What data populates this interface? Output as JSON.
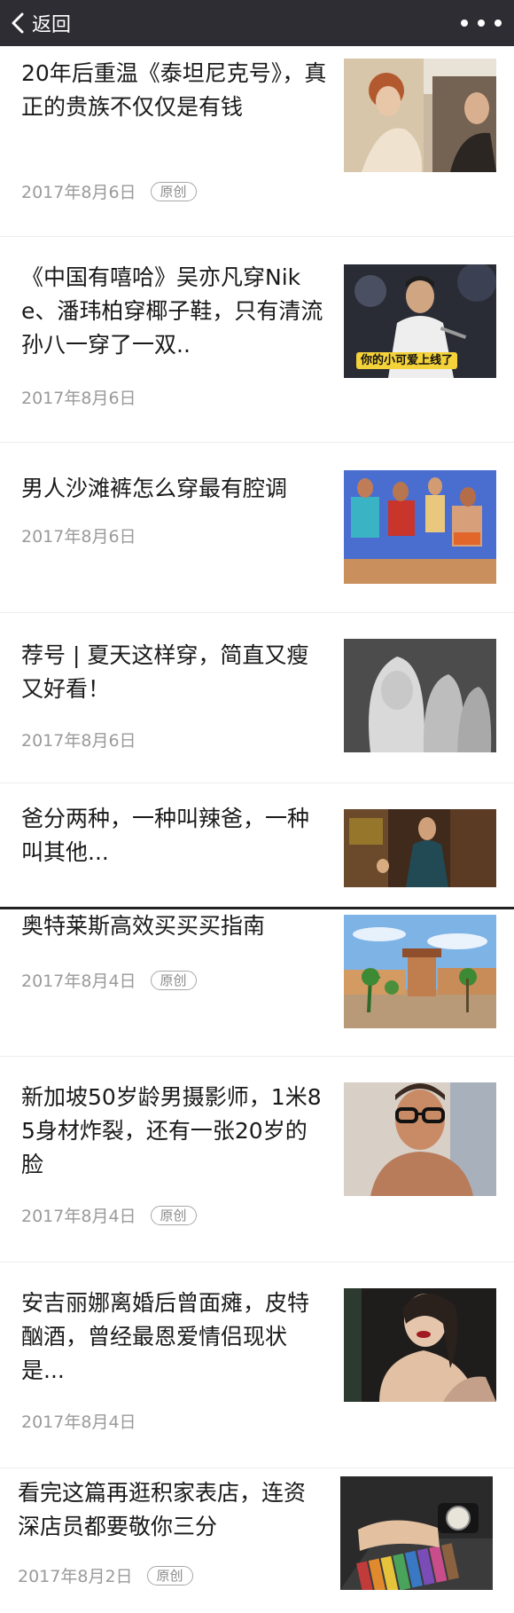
{
  "nav": {
    "back_label": "返回"
  },
  "articles": [
    {
      "title": "20年后重温《泰坦尼克号》，真正的贵族不仅仅是有钱",
      "date": "2017年8月6日",
      "badge": "原创"
    },
    {
      "title": "《中国有嘻哈》吴亦凡穿Nike、潘玮柏穿椰子鞋，只有清流孙八一穿了一双..",
      "date": "2017年8月6日",
      "thumb_caption": "你的小可爱上线了"
    },
    {
      "title": "男人沙滩裤怎么穿最有腔调",
      "date": "2017年8月6日"
    },
    {
      "title": "荐号 | 夏天这样穿，简直又瘦又好看！",
      "date": "2017年8月6日"
    },
    {
      "title": "爸分两种，一种叫辣爸，一种叫其他..."
    },
    {
      "title": "奥特莱斯高效买买买指南",
      "date": "2017年8月4日",
      "badge": "原创"
    },
    {
      "title": "新加坡50岁龄男摄影师，1米85身材炸裂，还有一张20岁的脸",
      "date": "2017年8月4日",
      "badge": "原创"
    },
    {
      "title": "安吉丽娜离婚后曾面瘫，皮特酗酒，曾经最恩爱情侣现状是...",
      "date": "2017年8月4日"
    },
    {
      "title": "看完这篇再逛积家表店，连资深店员都要敬你三分",
      "date": "2017年8月2日",
      "badge": "原创"
    }
  ]
}
